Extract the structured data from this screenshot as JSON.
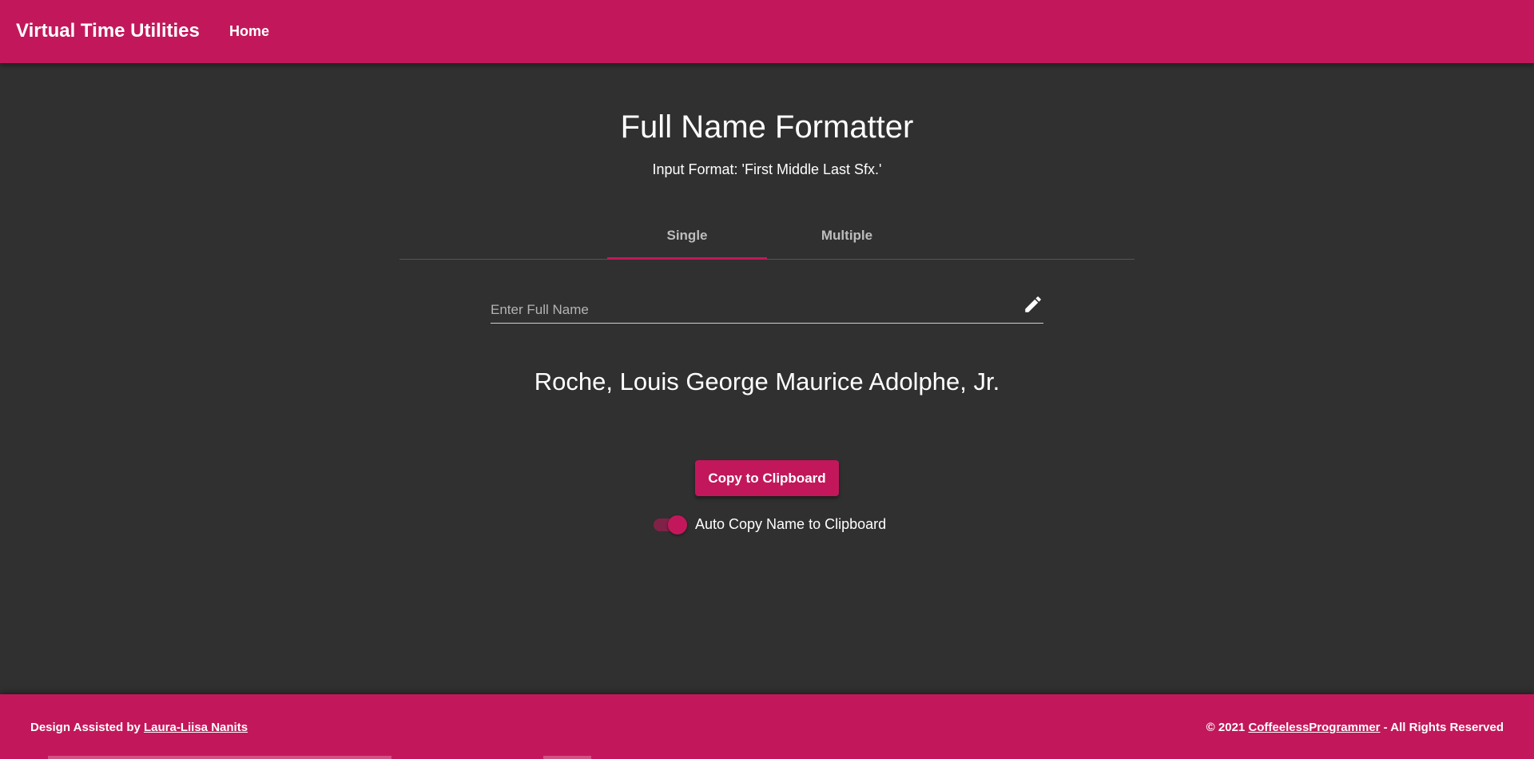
{
  "header": {
    "app_title": "Virtual Time Utilities",
    "nav_home": "Home"
  },
  "main": {
    "title": "Full Name Formatter",
    "subtitle": "Input Format: 'First Middle Last Sfx.'",
    "tabs": [
      {
        "label": "Single",
        "selected": true
      },
      {
        "label": "Multiple",
        "selected": false
      }
    ],
    "name_input": {
      "placeholder": "Enter Full Name",
      "value": ""
    },
    "formatted_result": "Roche, Louis George Maurice Adolphe, Jr.",
    "copy_button_label": "Copy to Clipboard",
    "auto_copy": {
      "label": "Auto Copy Name to Clipboard",
      "enabled": true
    }
  },
  "footer": {
    "left_prefix": "Design Assisted by ",
    "left_link": "Laura-Liisa Nanits",
    "right_prefix": "© 2021 ",
    "right_link": "CoffeelessProgrammer",
    "right_suffix": " - All Rights Reserved"
  },
  "colors": {
    "primary": "#c2185b",
    "background": "#303030",
    "text": "#ffffff"
  },
  "icons": {
    "input_suffix": "pencil-icon"
  }
}
